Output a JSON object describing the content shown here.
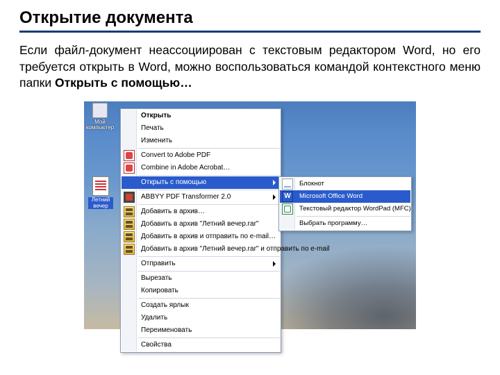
{
  "title": "Открытие документа",
  "body_pre": "Если файл-документ неассоциирован с текстовым редактором Word, но его требуется открыть в Word, можно воспользоваться командой контекстного меню папки ",
  "body_bold": "Открыть с помощью…",
  "desktop": {
    "icon1": "Мой",
    "icon2": "компьютер",
    "selected_file": "Летний вечер"
  },
  "context_menu": {
    "open": "Открыть",
    "print": "Печать",
    "edit": "Изменить",
    "convert_pdf": "Convert to Adobe PDF",
    "combine_pdf": "Combine in Adobe Acrobat…",
    "open_with": "Открыть с помощью",
    "abbyy": "ABBYY PDF Transformer 2.0",
    "add_arch": "Добавить в архив…",
    "add_arch_named": "Добавить в архив \"Летний вечер.rar\"",
    "add_email": "Добавить в архив и отправить по e-mail…",
    "add_named_email": "Добавить в архив \"Летний вечер.rar\" и отправить по e-mail",
    "send": "Отправить",
    "cut": "Вырезать",
    "copy": "Копировать",
    "shortcut": "Создать ярлык",
    "delete": "Удалить",
    "rename": "Переименовать",
    "props": "Свойства"
  },
  "submenu": {
    "notepad": "Блокнот",
    "word": "Microsoft Office Word",
    "wordpad": "Текстовый редактор WordPad (MFC)",
    "choose": "Выбрать программу…"
  }
}
